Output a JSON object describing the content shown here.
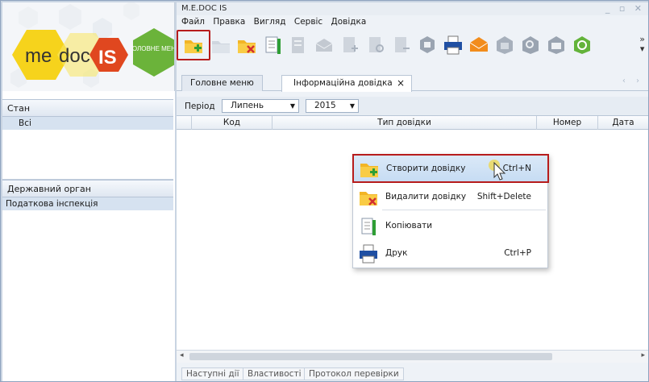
{
  "window": {
    "title": "M.E.DOC IS"
  },
  "logo": {
    "text_me": "me",
    "text_doc": "doc",
    "text_is": "IS",
    "menu_badge": "ГОЛОВНЕ МЕНЮ"
  },
  "menu": [
    "Файл",
    "Правка",
    "Вигляд",
    "Сервіс",
    "Довідка"
  ],
  "tabs": [
    {
      "label": "Головне меню",
      "active": false
    },
    {
      "label": "Інформаційна довідка",
      "active": true,
      "close": "×"
    }
  ],
  "sidebar": {
    "state_header": "Стан",
    "state_items": [
      "Всі"
    ],
    "organ_header": "Державний орган",
    "organ_items": [
      "Податкова інспекція"
    ]
  },
  "filter": {
    "period_label": "Період",
    "month": "Липень",
    "year": "2015"
  },
  "grid": {
    "columns": [
      "Код",
      "Тип довідки",
      "Номер",
      "Дата"
    ]
  },
  "context_menu": [
    {
      "label": "Створити довідку",
      "shortcut": "Ctrl+N",
      "icon": "folder-add-icon"
    },
    {
      "label": "Видалити довідку",
      "shortcut": "Shift+Delete",
      "icon": "folder-delete-icon"
    },
    {
      "label": "Копіювати",
      "shortcut": "",
      "icon": "copy-icon"
    },
    {
      "label": "Друк",
      "shortcut": "Ctrl+P",
      "icon": "printer-icon"
    }
  ],
  "bottom_tabs": [
    "Наступні дії",
    "Властивості",
    "Протокол перевірки"
  ],
  "colors": {
    "accent_red": "#b71c1c",
    "logo_yellow": "#f6d31c",
    "logo_red": "#e0471f",
    "logo_green": "#6bb33a"
  }
}
